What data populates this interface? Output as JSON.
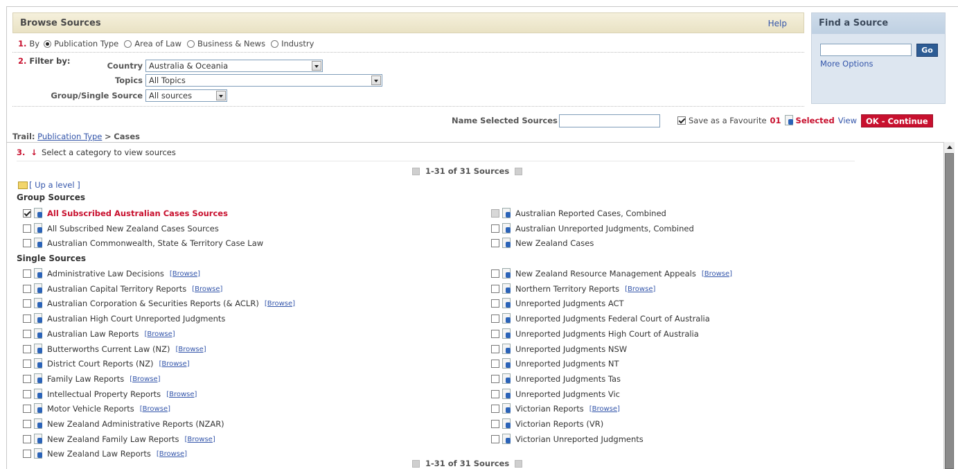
{
  "browse": {
    "title": "Browse Sources",
    "help": "Help",
    "step1_num": "1.",
    "step1_label": "By",
    "by_options": [
      "Publication Type",
      "Area of Law",
      "Business & News",
      "Industry"
    ],
    "step2_num": "2.",
    "step2_label": "Filter by:",
    "country_label": "Country",
    "country_value": "Australia & Oceania",
    "topics_label": "Topics",
    "topics_value": "All Topics",
    "group_label": "Group/Single Source",
    "group_value": "All sources"
  },
  "find": {
    "title": "Find a Source",
    "go": "Go",
    "more_options": "More Options"
  },
  "selection": {
    "name_label": "Name Selected Sources",
    "save_fav": "Save as a Favourite",
    "count": "01",
    "selected": "Selected",
    "view": "View",
    "ok": "OK - Continue"
  },
  "trail": {
    "label": "Trail:",
    "link": "Publication Type",
    "sep": ">",
    "current": "Cases"
  },
  "list": {
    "step3_num": "3.",
    "step3_text": "Select a category to view sources",
    "pager": "1-31 of 31 Sources",
    "up_level": "[ Up a level ]",
    "group_title": "Group Sources",
    "single_title": "Single Sources",
    "browse_link": "[Browse]",
    "group_left": [
      {
        "name": "All Subscribed Australian Cases Sources",
        "checked": true
      },
      {
        "name": "All Subscribed New Zealand Cases Sources"
      },
      {
        "name": "Australian Commonwealth, State & Territory Case Law"
      }
    ],
    "group_right": [
      {
        "name": "Australian Reported Cases, Combined",
        "disabled": true
      },
      {
        "name": "Australian Unreported Judgments, Combined"
      },
      {
        "name": "New Zealand Cases"
      }
    ],
    "single_left": [
      {
        "name": "Administrative Law Decisions",
        "browse": true
      },
      {
        "name": "Australian Capital Territory Reports",
        "browse": true
      },
      {
        "name": "Australian Corporation & Securities Reports (& ACLR)",
        "browse": true
      },
      {
        "name": "Australian High Court Unreported Judgments"
      },
      {
        "name": "Australian Law Reports",
        "browse": true
      },
      {
        "name": "Butterworths Current Law (NZ)",
        "browse": true
      },
      {
        "name": "District Court Reports (NZ)",
        "browse": true
      },
      {
        "name": "Family Law Reports",
        "browse": true
      },
      {
        "name": "Intellectual Property Reports",
        "browse": true
      },
      {
        "name": "Motor Vehicle Reports",
        "browse": true
      },
      {
        "name": "New Zealand Administrative Reports (NZAR)"
      },
      {
        "name": "New Zealand Family Law Reports",
        "browse": true
      },
      {
        "name": "New Zealand Law Reports",
        "browse": true
      }
    ],
    "single_right": [
      {
        "name": "New Zealand Resource Management Appeals",
        "browse": true
      },
      {
        "name": "Northern Territory Reports",
        "browse": true
      },
      {
        "name": "Unreported Judgments ACT"
      },
      {
        "name": "Unreported Judgments Federal Court of Australia"
      },
      {
        "name": "Unreported Judgments High Court of Australia"
      },
      {
        "name": "Unreported Judgments NSW"
      },
      {
        "name": "Unreported Judgments NT"
      },
      {
        "name": "Unreported Judgments Tas"
      },
      {
        "name": "Unreported Judgments Vic"
      },
      {
        "name": "Victorian Reports",
        "browse": true
      },
      {
        "name": "Victorian Reports (VR)"
      },
      {
        "name": "Victorian Unreported Judgments"
      }
    ]
  }
}
